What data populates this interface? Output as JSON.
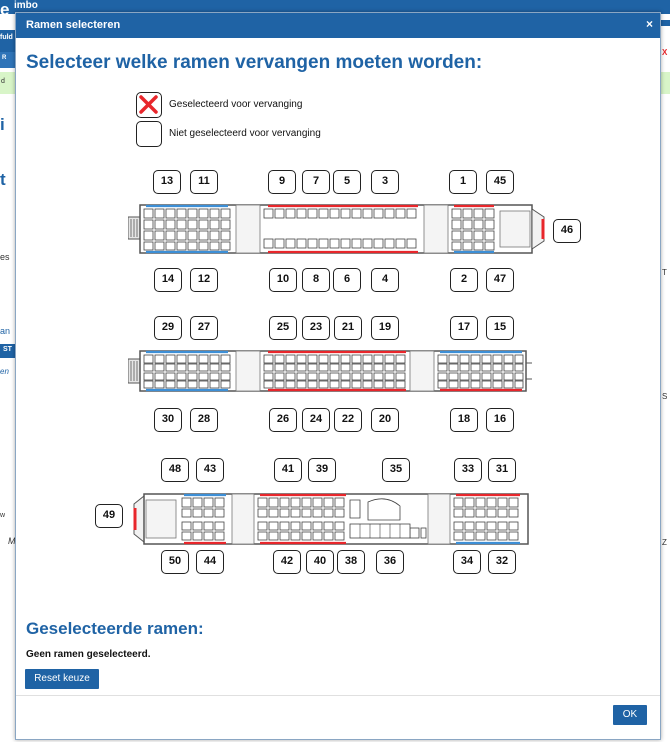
{
  "background": {
    "top_fragment": "imbo",
    "left_fragments": [
      "e",
      "fuld",
      "R",
      "d",
      "i",
      "t",
      "es",
      "an",
      "ST",
      "en",
      "w",
      "M"
    ],
    "right_fragments": [
      "X",
      "T",
      "S",
      "Z"
    ]
  },
  "dialog": {
    "title": "Ramen selecteren",
    "close_label": "×",
    "heading": "Selecteer welke ramen vervangen moeten worden:"
  },
  "legend": {
    "selected_label": "Geselecteerd voor vervanging",
    "not_selected_label": "Niet geselecteerd voor vervanging",
    "selected_icon": "red-x-icon"
  },
  "cars": [
    {
      "name": "car-1",
      "top_windows": [
        "13",
        "11",
        "9",
        "7",
        "5",
        "3",
        "1",
        "45"
      ],
      "bottom_windows": [
        "14",
        "12",
        "10",
        "8",
        "6",
        "4",
        "2",
        "47"
      ],
      "side_windows": [
        "46"
      ]
    },
    {
      "name": "car-2",
      "top_windows": [
        "29",
        "27",
        "25",
        "23",
        "21",
        "19",
        "17",
        "15"
      ],
      "bottom_windows": [
        "30",
        "28",
        "26",
        "24",
        "22",
        "20",
        "18",
        "16"
      ],
      "side_windows": []
    },
    {
      "name": "car-3",
      "top_windows": [
        "48",
        "43",
        "41",
        "39",
        "35",
        "33",
        "31"
      ],
      "bottom_windows": [
        "50",
        "44",
        "42",
        "40",
        "38",
        "36",
        "34",
        "32"
      ],
      "side_windows": [
        "49"
      ]
    }
  ],
  "selection": {
    "heading": "Geselecteerde ramen:",
    "none_text": "Geen ramen geselecteerd.",
    "reset_label": "Reset keuze",
    "ok_label": "OK"
  },
  "colors": {
    "accent": "#1f63a5",
    "selected_red": "#e8262b",
    "seat_blue": "#3d8fd6"
  }
}
